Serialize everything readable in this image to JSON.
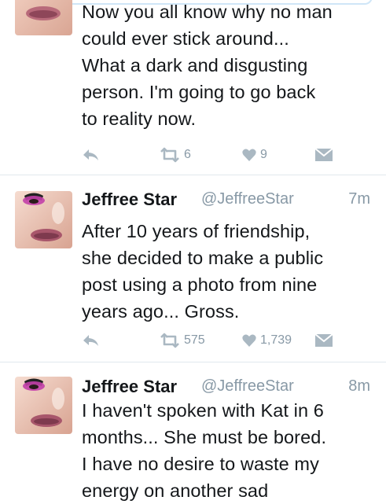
{
  "colors": {
    "icon_gray": "#aab8c2",
    "meta_gray": "#8899a6",
    "text": "#14171a",
    "divider": "#e1e8ed"
  },
  "tweets": [
    {
      "text": "Now you all know why no man\ncould ever stick around...\nWhat a dark and disgusting\nperson. I'm going to go back\nto reality now.",
      "retweets": "6",
      "likes": "9"
    },
    {
      "name": "Jeffree Star",
      "handle": "@JeffreeStar",
      "time": "7m",
      "text": "After 10 years of friendship,\nshe decided to make a public\npost using a photo from nine\nyears ago... Gross.",
      "retweets": "575",
      "likes": "1,739"
    },
    {
      "name": "Jeffree Star",
      "handle": "@JeffreeStar",
      "time": "8m",
      "text": "I haven't spoken with Kat in 6\nmonths... She must be bored.\nI have no desire to waste my\nenergy on another sad"
    }
  ],
  "icons": {
    "reply": "reply-icon",
    "retweet": "retweet-icon",
    "like": "heart-icon",
    "dm": "envelope-icon"
  }
}
